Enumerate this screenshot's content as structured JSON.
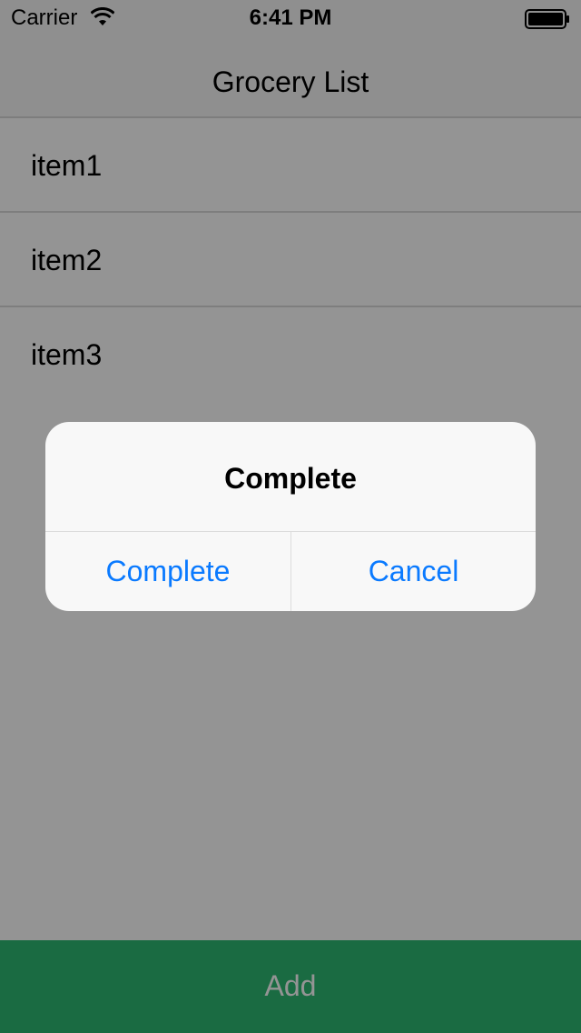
{
  "status_bar": {
    "carrier": "Carrier",
    "time": "6:41 PM",
    "wifi_icon": "wifi-icon",
    "battery_icon": "battery-icon"
  },
  "nav": {
    "title": "Grocery List"
  },
  "list": {
    "items": [
      {
        "label": "item1"
      },
      {
        "label": "item2"
      },
      {
        "label": "item3"
      }
    ]
  },
  "add_button": {
    "label": "Add",
    "color": "#2db873"
  },
  "alert": {
    "title": "Complete",
    "buttons": [
      {
        "label": "Complete"
      },
      {
        "label": "Cancel"
      }
    ],
    "button_color": "#0a7aff"
  }
}
